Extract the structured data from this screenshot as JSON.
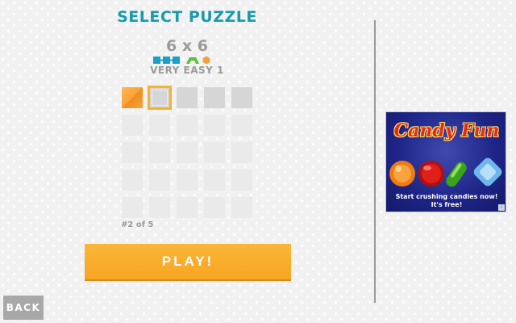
{
  "header": {
    "title": "SELECT PUZZLE",
    "size_label": "6 x 6",
    "difficulty": "VERY EASY 1"
  },
  "legend_icons": [
    "square-icon",
    "square-icon",
    "square-icon",
    "bridge-icon",
    "hexagon-icon"
  ],
  "puzzles": [
    {
      "number": 1,
      "state": "solved"
    },
    {
      "number": 2,
      "state": "selected"
    },
    {
      "number": 3,
      "state": "unsolved"
    },
    {
      "number": 4,
      "state": "unsolved"
    },
    {
      "number": 5,
      "state": "unsolved"
    }
  ],
  "ghost_rows": 4,
  "counter": "#2 of 5",
  "play_button": {
    "label": "PLAY!"
  },
  "back_button": {
    "label": "BACK"
  },
  "ad": {
    "title": "Candy Fun",
    "line1": "Start crushing candies now!",
    "line2": "It's free!",
    "badge": "i"
  },
  "colors": {
    "title": "#1a9aaa",
    "accent": "#f6a622",
    "shape_blue": "#1aa0c8",
    "shape_green": "#5cbf3c",
    "shape_orange": "#f2a03a"
  }
}
